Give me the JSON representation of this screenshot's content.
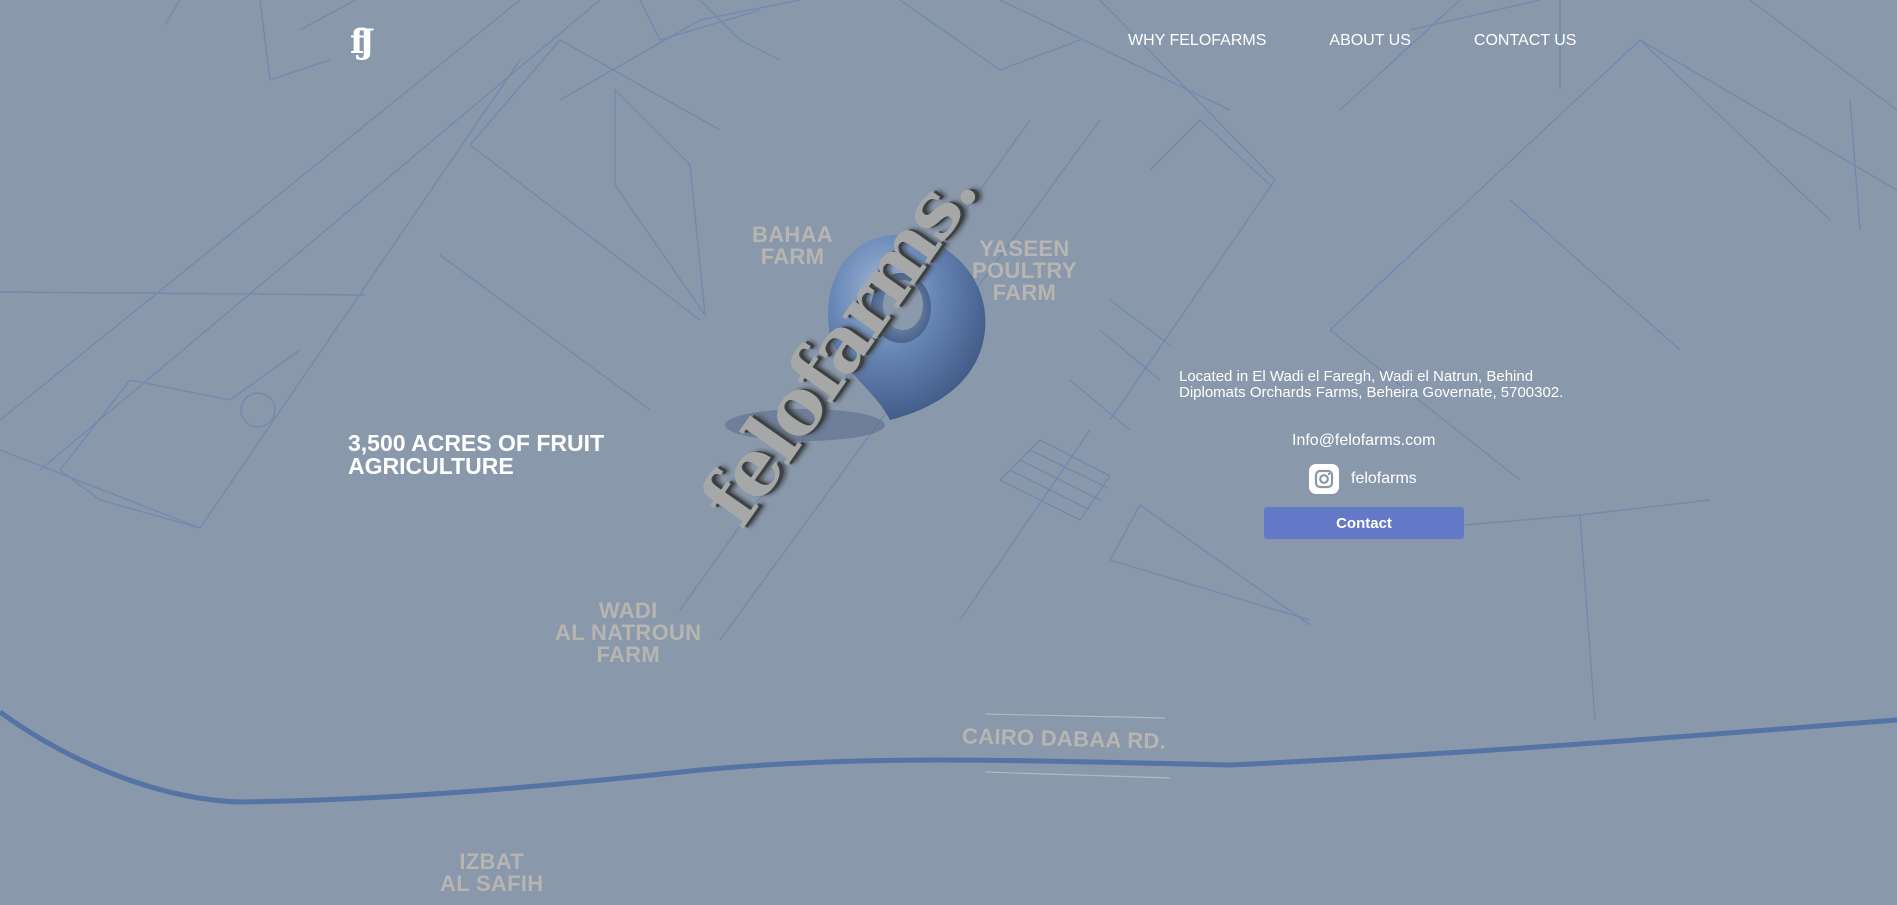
{
  "brand": {
    "logo_text": "fJ"
  },
  "nav": {
    "items": [
      "WHY FELOFARMS",
      "ABOUT US",
      "CONTACT US"
    ]
  },
  "hero": {
    "tagline": "3,500 ACRES OF FRUIT AGRICULTURE",
    "wordmark": "felofarms."
  },
  "map_labels": {
    "bahaa": [
      "BAHAA",
      "FARM"
    ],
    "yaseen": [
      "YASEEN",
      "POULTRY",
      "FARM"
    ],
    "wadi": [
      "WADI",
      "AL NATROUN",
      "FARM"
    ],
    "road": "CAIRO DABAA RD.",
    "izbat": [
      "IZBAT",
      "AL SAFIH"
    ]
  },
  "contact": {
    "address": "Located in El Wadi el Faregh, Wadi el Natrun, Behind Diplomats Orchards Farms, Beheira Governate, 5700302.",
    "email": "Info@felofarms.com",
    "instagram_handle": "felofarms",
    "instagram_icon": "instagram-icon",
    "button_label": "Contact"
  },
  "colors": {
    "background": "#8a98ab",
    "map_lines": "#6b86b0",
    "road": "#4f6fa3",
    "pin": "#5f7fae",
    "button": "#6379c8",
    "map_label": "#b7b5b1"
  }
}
